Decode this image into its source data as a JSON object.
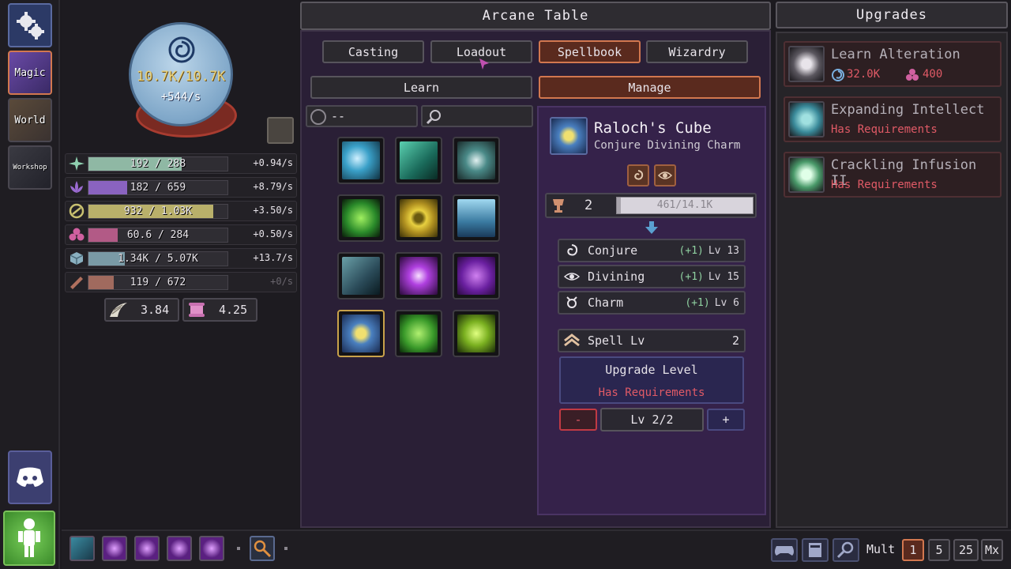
{
  "sidebar": {
    "items": [
      {
        "label": "",
        "icon": "settings-gear-icon"
      },
      {
        "label": "Magic",
        "icon": "magic-crystal-icon"
      },
      {
        "label": "World",
        "icon": "world-icon"
      },
      {
        "label": "Workshop",
        "icon": "workshop-icon"
      },
      {
        "label": "",
        "icon": "discord-icon"
      },
      {
        "label": "",
        "icon": "character-icon"
      }
    ]
  },
  "mana_orb": {
    "current": "10.7K/10.7K",
    "rate": "+544/s"
  },
  "resources": [
    {
      "value": "192 / 288",
      "rate": "+0.94/s",
      "fill": 0.67,
      "color": "#8fb8a4"
    },
    {
      "value": "182 / 659",
      "rate": "+8.79/s",
      "fill": 0.28,
      "color": "#8a63c0"
    },
    {
      "value": "932 / 1.03K",
      "rate": "+3.50/s",
      "fill": 0.9,
      "color": "#b9b06a"
    },
    {
      "value": "60.6 / 284",
      "rate": "+0.50/s",
      "fill": 0.21,
      "color": "#b25a86"
    },
    {
      "value": "1.34K / 5.07K",
      "rate": "+13.7/s",
      "fill": 0.26,
      "color": "#7a9aa6"
    },
    {
      "value": "119 / 672",
      "rate": "+0/s",
      "fill": 0.18,
      "color": "#a06a5e"
    }
  ],
  "badges": [
    {
      "value": "3.84",
      "icon": "wing-icon"
    },
    {
      "value": "4.25",
      "icon": "scroll-icon"
    }
  ],
  "arcane": {
    "title": "Arcane Table",
    "tabs": [
      "Casting",
      "Loadout",
      "Spellbook",
      "Wizardry"
    ],
    "subtabs": [
      "Learn",
      "Manage"
    ],
    "filter_value": "--",
    "search_placeholder": ""
  },
  "spell_detail": {
    "name": "Raloch's Cube",
    "subtitle": "Conjure Divining Charm",
    "level": "2",
    "xp": "461/14.1K",
    "xp_fill": 0.03,
    "schools": [
      {
        "name": "Conjure",
        "plus": "(+1)",
        "lv": "Lv 13"
      },
      {
        "name": "Divining",
        "plus": "(+1)",
        "lv": "Lv 15"
      },
      {
        "name": "Charm",
        "plus": "(+1)",
        "lv": "Lv 6"
      }
    ],
    "spell_lv_label": "Spell Lv",
    "spell_lv_value": "2",
    "upgrade_title": "Upgrade Level",
    "upgrade_req": "Has Requirements",
    "minus": "-",
    "plus": "+",
    "lv_display": "Lv 2/2"
  },
  "upgrades": {
    "title": "Upgrades",
    "items": [
      {
        "name": "Learn Alteration",
        "cost1": "32.0K",
        "cost2": "400"
      },
      {
        "name": "Expanding Intellect",
        "req": "Has Requirements"
      },
      {
        "name": "Crackling Infusion II",
        "req": "Has Requirements"
      }
    ]
  },
  "bottom_bar": {
    "mult_label": "Mult",
    "mult_options": [
      "1",
      "5",
      "25",
      "Mx"
    ]
  }
}
